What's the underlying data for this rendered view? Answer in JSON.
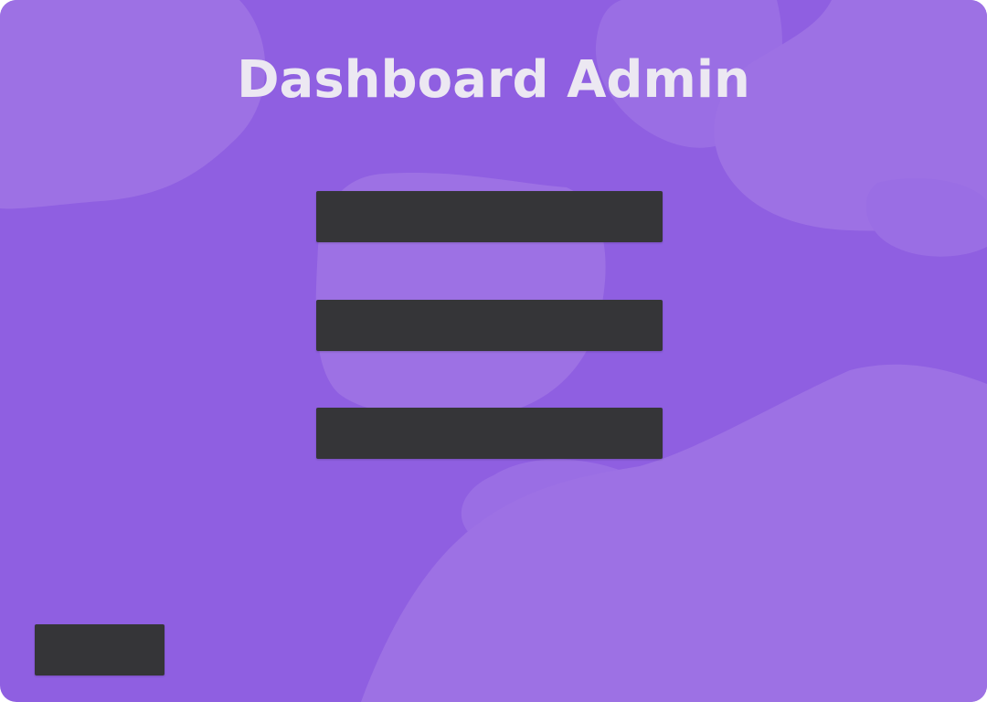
{
  "app": {
    "title": "Dashboard Admin"
  },
  "menu": {
    "buttons": [
      {
        "label": ""
      },
      {
        "label": ""
      },
      {
        "label": ""
      }
    ]
  },
  "footer": {
    "corner_button_label": ""
  },
  "colors": {
    "background": "#8f5fe1",
    "background_blob": "#9d71e4",
    "button": "#353538",
    "title_text": "#ece8f2"
  }
}
